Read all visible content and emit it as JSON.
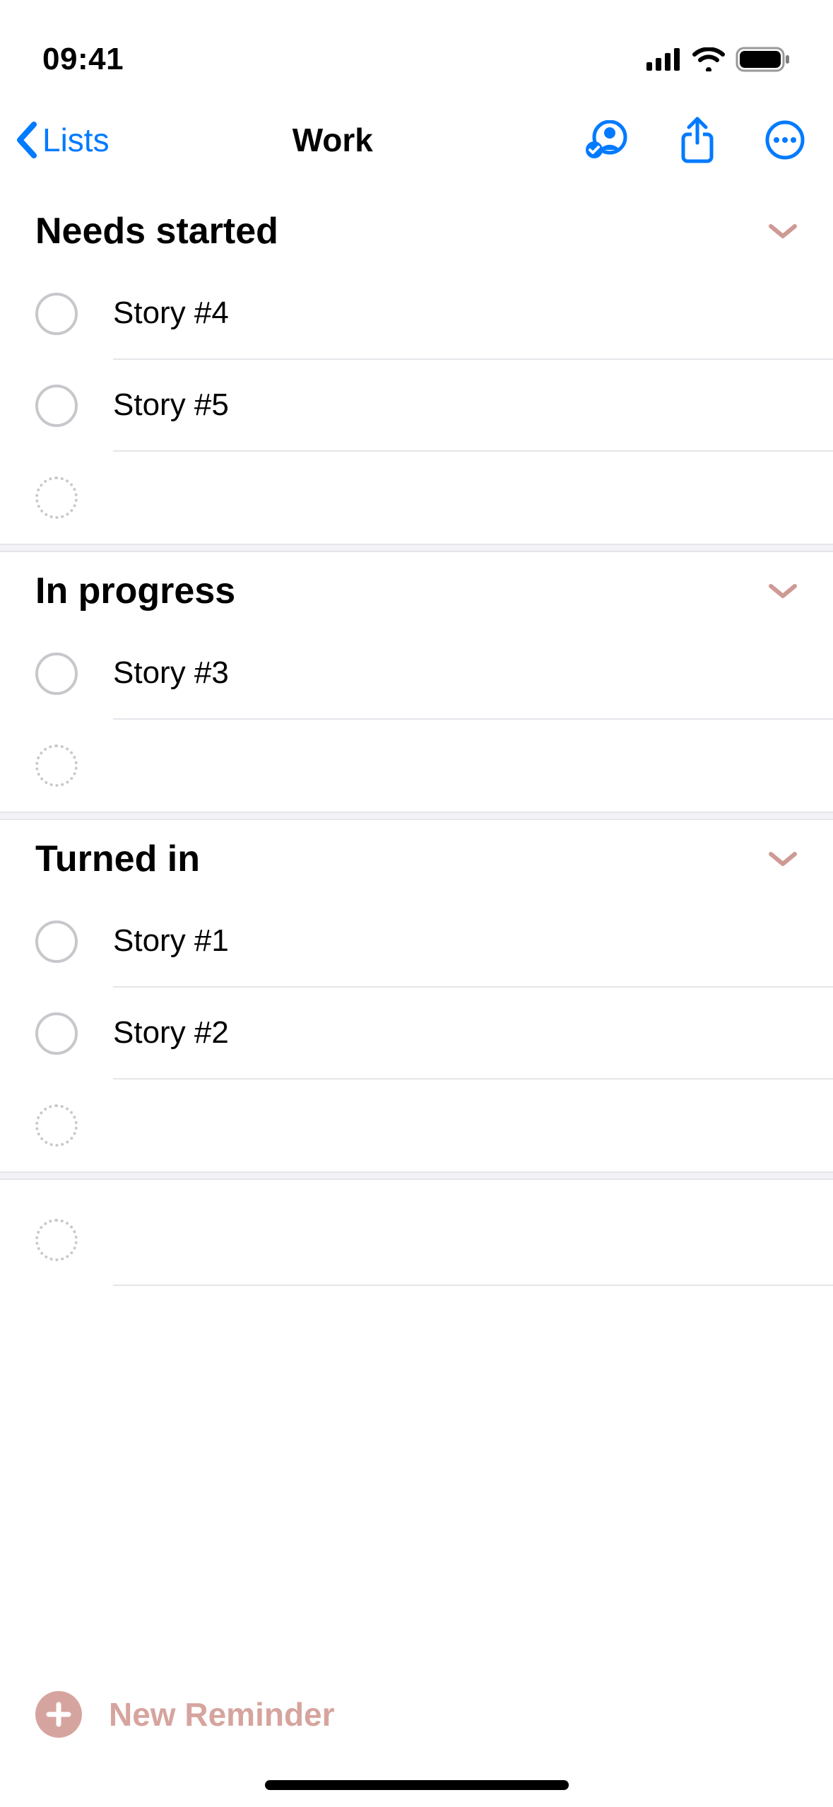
{
  "status": {
    "time": "09:41"
  },
  "nav": {
    "back_label": "Lists",
    "title": "Work"
  },
  "sections": [
    {
      "title": "Needs started",
      "items": [
        "Story #4",
        "Story #5"
      ]
    },
    {
      "title": "In progress",
      "items": [
        "Story #3"
      ]
    },
    {
      "title": "Turned in",
      "items": [
        "Story #1",
        "Story #2"
      ]
    }
  ],
  "footer": {
    "new_reminder_label": "New Reminder"
  },
  "colors": {
    "accent": "#007AFF",
    "list_accent": "#D6A49E"
  }
}
